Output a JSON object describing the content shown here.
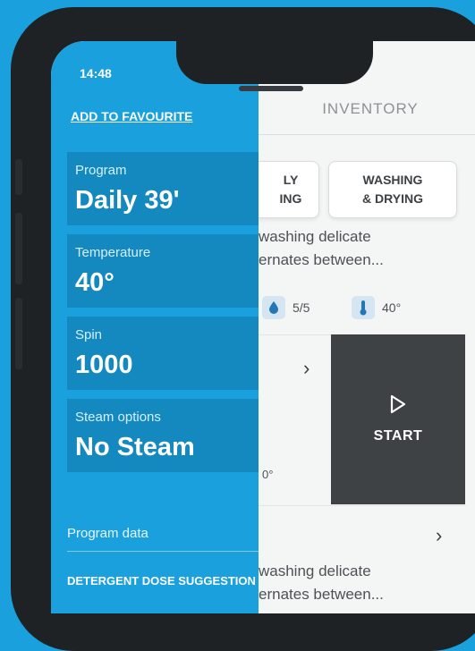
{
  "status_bar": {
    "time": "14:48"
  },
  "panel": {
    "add_to_favourite": "ADD TO FAVOURITE",
    "settings": [
      {
        "label": "Program",
        "value": "Daily 39'"
      },
      {
        "label": "Temperature",
        "value": "40°"
      },
      {
        "label": "Spin",
        "value": "1000"
      },
      {
        "label": "Steam options",
        "value": "No Steam"
      }
    ],
    "program_data": "Program data",
    "detergent_dose": "DETERGENT DOSE SUGGESTION"
  },
  "background": {
    "inventory_tab": "INVENTORY",
    "chip_partial_line1": "LY",
    "chip_partial_line2": "ING",
    "chip_washing_line1": "WASHING",
    "chip_washing_line2": "& DRYING",
    "desc1_line1": "washing delicate",
    "desc1_line2": "ernates between...",
    "stat_level": "5/5",
    "stat_temp": "40°",
    "card_partial_temp": "0°",
    "start_label": "START",
    "desc2_line1": "washing delicate",
    "desc2_line2": "ernates between..."
  },
  "colors": {
    "accent": "#1aa0dc",
    "panel_block": "#1489c0",
    "start_bg": "#3e4244"
  },
  "icons": {
    "level": "drop-icon",
    "temperature": "thermometer-icon",
    "start": "play-icon",
    "chevron": "chevron-right-icon"
  }
}
